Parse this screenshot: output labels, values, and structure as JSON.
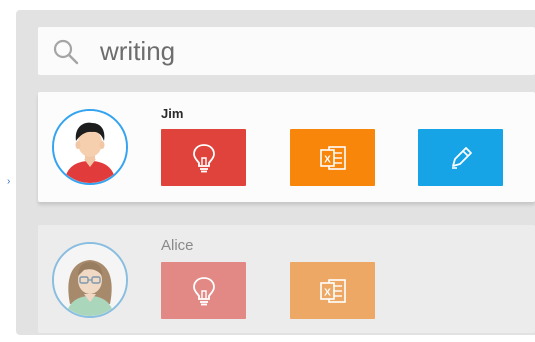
{
  "search": {
    "value": "writing",
    "icon": "search-icon"
  },
  "colors": {
    "accent": "#35a4f0",
    "idea": "#e0433c",
    "excel": "#f7860a",
    "write": "#16a4e6",
    "idea_faded": "#e38985",
    "excel_faded": "#eda865"
  },
  "users": [
    {
      "name": "Jim",
      "avatar": "avatar-man",
      "tools": [
        "lightbulb-icon",
        "excel-icon",
        "pen-icon"
      ]
    },
    {
      "name": "Alice",
      "avatar": "avatar-woman",
      "tools": [
        "lightbulb-icon",
        "excel-icon"
      ]
    }
  ]
}
